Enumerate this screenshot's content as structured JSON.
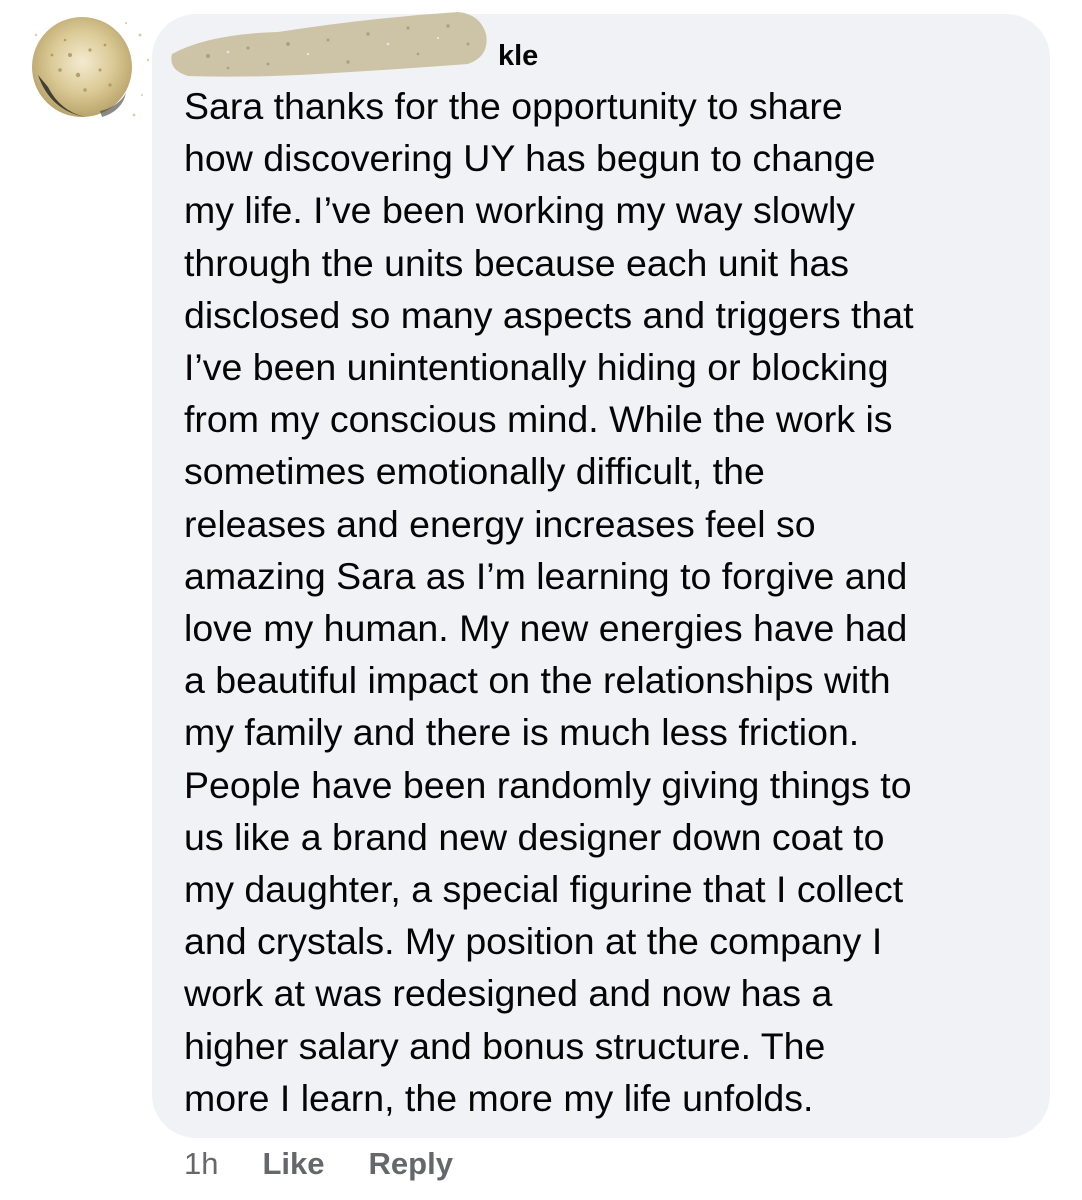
{
  "comment": {
    "author_visible_fragment": "kle",
    "text_lines": [
      "Sara thanks for the opportunity to share",
      "how discovering UY has begun to change",
      "my life. I’ve been working my way slowly",
      "through the units because each unit has",
      "disclosed so many aspects and triggers that",
      "I’ve been unintentionally hiding or blocking",
      "from my conscious mind. While the work is",
      "sometimes emotionally difficult, the",
      "releases and energy increases feel so",
      "amazing Sara as I’m learning to forgive and",
      "love my human. My new energies have had",
      "a beautiful impact on the relationships with",
      "my family and there  is much less friction.",
      "People have been randomly giving things to",
      "us like a brand new designer down coat to",
      "my daughter, a special figurine that I collect",
      "and crystals. My position at the  company I",
      "work at was redesigned and now has a",
      "higher salary and bonus structure. The",
      "more I learn, the more my life unfolds."
    ]
  },
  "actions": {
    "time": "1h",
    "like": "Like",
    "reply": "Reply"
  },
  "icons": {
    "avatar": "avatar-image"
  },
  "colors": {
    "bubble": "#f0f2f5",
    "text": "#050505",
    "meta": "#65676b",
    "glitter": "#c9b98a"
  }
}
